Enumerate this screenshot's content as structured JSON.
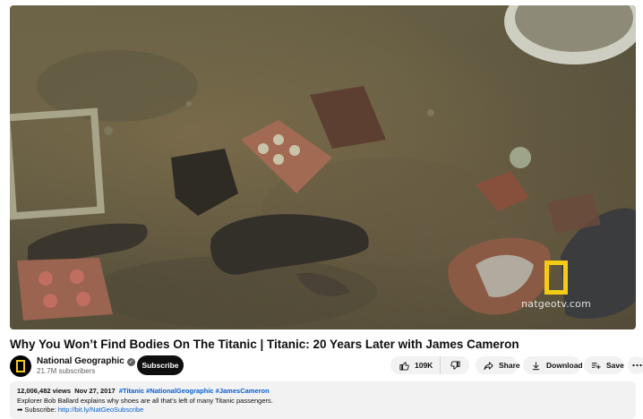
{
  "video": {
    "watermark_text": "natgeotv.com",
    "brand_yellow": "#f5cc13"
  },
  "title": "Why You Won’t Find Bodies On The Titanic | Titanic: 20 Years Later with James Cameron",
  "channel": {
    "name": "National Geographic",
    "subscribers": "21.7M subscribers",
    "subscribe_label": "Subscribe",
    "verified_icon": "check-circle-icon"
  },
  "actions": {
    "like_count": "109K",
    "share_label": "Share",
    "download_label": "Download",
    "save_label": "Save"
  },
  "description": {
    "views": "12,006,482 views",
    "date": "Nov 27, 2017",
    "hashtags": "#Titanic #NationalGeographic #JamesCameron",
    "line1": "Explorer Bob Ballard explains why shoes are all that’s left of many Titanic passengers.",
    "subscribe_prefix": "➡ Subscribe: ",
    "subscribe_link": "http://bit.ly/NatGeoSubscribe"
  }
}
